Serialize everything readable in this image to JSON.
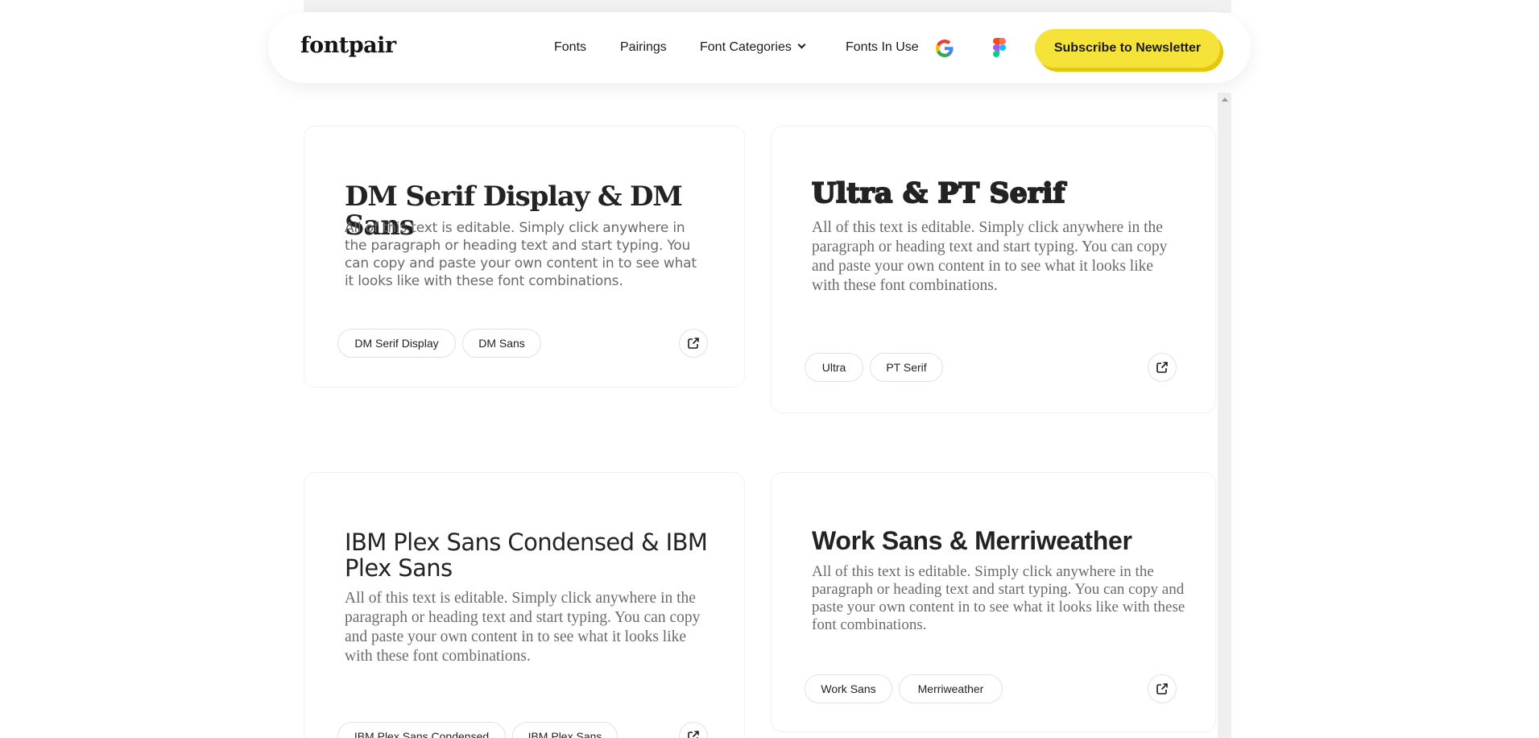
{
  "header": {
    "logo": "fontpair",
    "nav": {
      "fonts": "Fonts",
      "pairings": "Pairings",
      "font_categories": "Font Categories",
      "fonts_in_use": "Fonts In Use"
    },
    "cta": "Subscribe to Newsletter",
    "cta_color": "#f6e339"
  },
  "cards": [
    {
      "title": "DM Serif Display & DM Sans",
      "body": "All of this text is editable. Simply click anywhere in the paragraph or heading text and start typing. You can copy and paste your own content in to see what it looks like with these font combinations.",
      "tags": [
        "DM Serif Display",
        "DM Sans"
      ]
    },
    {
      "title": "Ultra & PT Serif",
      "body": "All of this text is editable. Simply click anywhere in the paragraph or heading text and start typing. You can copy and paste your own content in to see what it looks like with these font combinations.",
      "tags": [
        "Ultra",
        "PT Serif"
      ]
    },
    {
      "title": "IBM Plex Sans Condensed & IBM Plex Sans",
      "body": "All of this text is editable. Simply click anywhere in the paragraph or heading text and start typing. You can copy and paste your own content in to see what it looks like with these font combinations.",
      "tags": [
        "IBM Plex Sans Condensed",
        "IBM Plex Sans"
      ]
    },
    {
      "title": "Work Sans & Merriweather",
      "body": "All of this text is editable. Simply click anywhere in the paragraph or heading text and start typing. You can copy and paste your own content in to see what it looks like with these font combinations.",
      "tags": [
        "Work Sans",
        "Merriweather"
      ]
    }
  ],
  "icons": {
    "google": "google-icon",
    "figma": "figma-icon",
    "external": "external-link-icon",
    "chevron": "chevron-down-icon"
  }
}
